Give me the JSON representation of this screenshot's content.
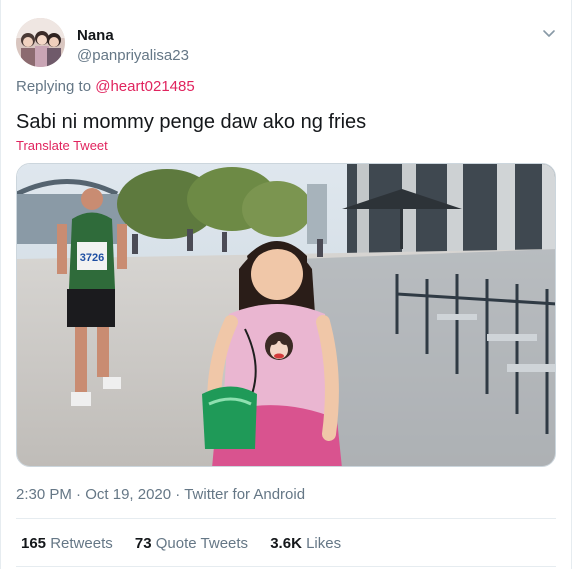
{
  "user": {
    "display_name": "Nana",
    "handle": "@panpriyalisa23"
  },
  "reply": {
    "prefix": "Replying to",
    "to_handle": "@heart021485"
  },
  "tweet": {
    "text": "Sabi ni mommy penge daw ako ng fries",
    "translate_label": "Translate Tweet"
  },
  "media": {
    "bib_number": "3726"
  },
  "meta": {
    "time": "2:30 PM",
    "separator": " · ",
    "date": "Oct 19, 2020",
    "source": "Twitter for Android"
  },
  "stats": {
    "retweets_count": "165",
    "retweets_label": "Retweets",
    "quotes_count": "73",
    "quotes_label": "Quote Tweets",
    "likes_count": "3.6K",
    "likes_label": "Likes"
  },
  "colors": {
    "accent": "#e0245e",
    "secondary_text": "#657786",
    "primary_text": "#14171a"
  }
}
